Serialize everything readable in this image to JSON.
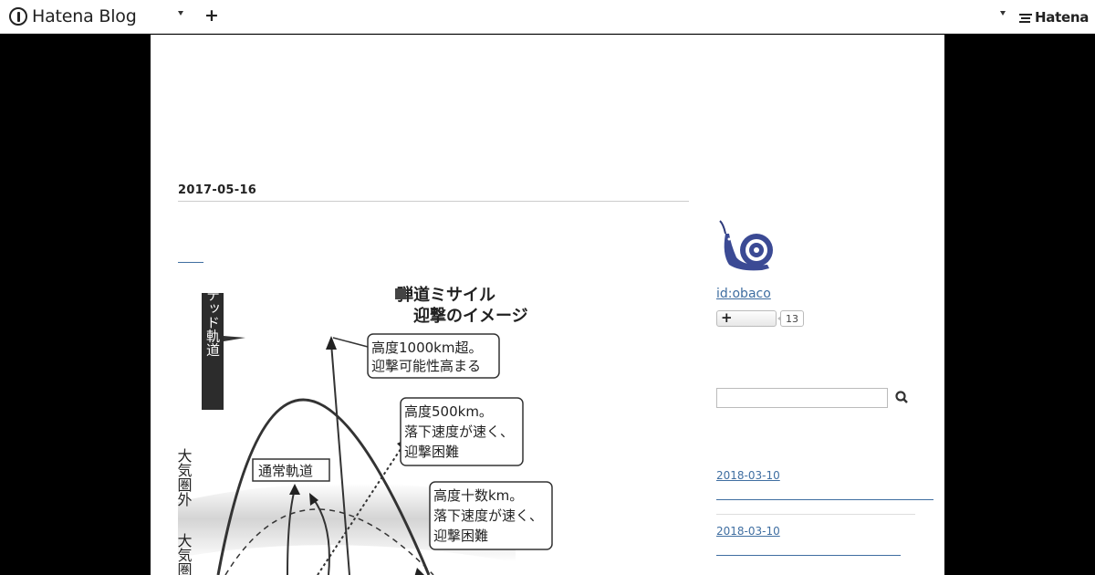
{
  "header": {
    "brand": "Hatena Blog",
    "right_brand": "Hatena"
  },
  "entry": {
    "date": "2017-05-16",
    "figure": {
      "title_line1": "弾道ミサイル",
      "title_line2": "迎撃のイメージ",
      "lofted_label": "ロフテッド軌道",
      "normal_label": "通常軌道",
      "atmosphere_outside": "大気圏外",
      "atmosphere_inside": "大気圏",
      "callout1": [
        "高度1000km超。",
        "迎撃可能性高まる"
      ],
      "callout2": [
        "高度500km。",
        "落下速度が速く、",
        "迎撃困難"
      ],
      "callout3": [
        "高度十数km。",
        "落下速度が速く、",
        "迎撃困難"
      ]
    }
  },
  "sidebar": {
    "user_id": "id:obaco",
    "reader_count": "13",
    "search": {
      "value": ""
    },
    "recent": [
      {
        "date": "2018-03-10"
      },
      {
        "date": "2018-03-10"
      }
    ]
  },
  "icons": {
    "brand": "hatena-blog-logo-icon",
    "plus": "plus-icon",
    "search": "search-icon",
    "avatar": "snail-avatar-icon"
  }
}
